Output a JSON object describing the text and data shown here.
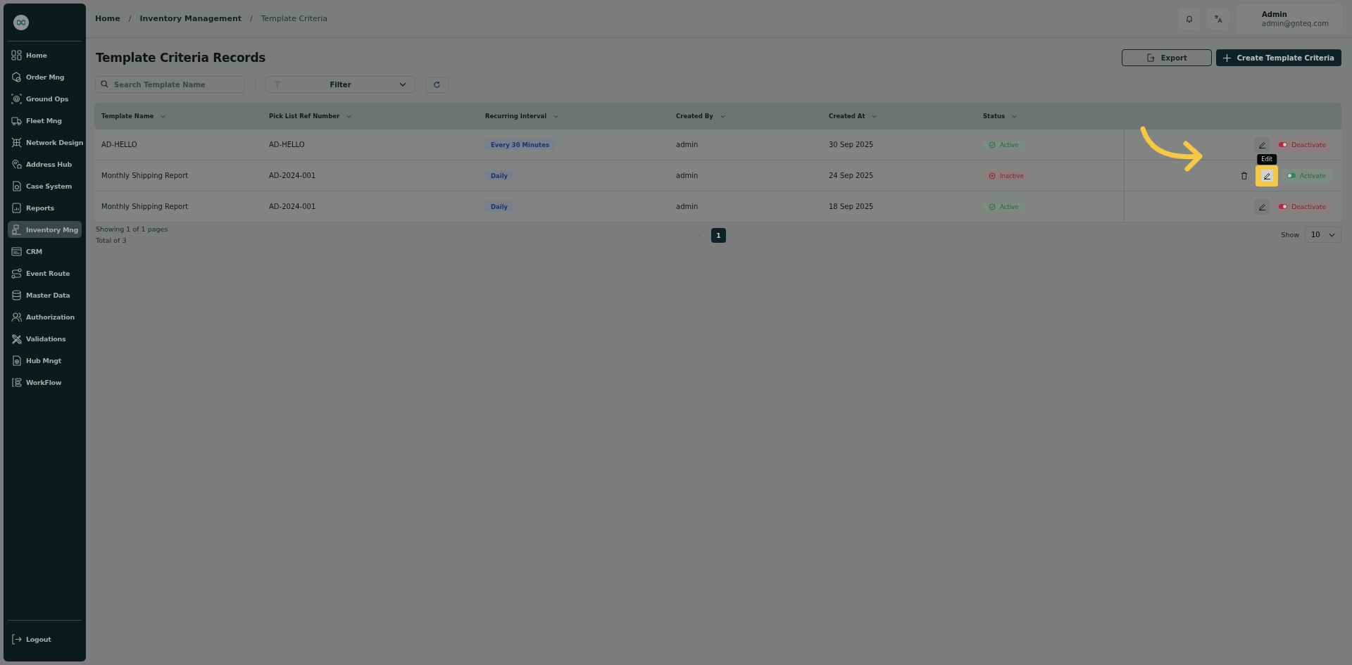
{
  "sidebar": {
    "items": [
      {
        "label": "Home",
        "selected": false
      },
      {
        "label": "Order Mng",
        "selected": false
      },
      {
        "label": "Ground Ops",
        "selected": false
      },
      {
        "label": "Fleet Mng",
        "selected": false
      },
      {
        "label": "Network Design",
        "selected": false
      },
      {
        "label": "Address Hub",
        "selected": false
      },
      {
        "label": "Case System",
        "selected": false
      },
      {
        "label": "Reports",
        "selected": false
      },
      {
        "label": "Inventory Mng",
        "selected": true
      },
      {
        "label": "CRM",
        "selected": false
      },
      {
        "label": "Event Route",
        "selected": false
      },
      {
        "label": "Master Data",
        "selected": false
      },
      {
        "label": "Authorization",
        "selected": false
      },
      {
        "label": "Validations",
        "selected": false
      },
      {
        "label": "Hub Mngt",
        "selected": false
      },
      {
        "label": "WorkFlow",
        "selected": false
      }
    ],
    "logout": "Logout"
  },
  "breadcrumb": [
    {
      "label": "Home",
      "current": false
    },
    {
      "label": "Inventory Management",
      "current": false
    },
    {
      "label": "Template Criteria",
      "current": true
    }
  ],
  "breadcrumb_separator": "/",
  "user": {
    "name": "Admin",
    "email": "admin@gnteq.com"
  },
  "page_title": "Template Criteria Records",
  "buttons": [
    {
      "label": "Export",
      "kind": "outline"
    },
    {
      "label": "Create Template Criteria",
      "kind": "primary"
    }
  ],
  "search": {
    "placeholder": "Search Template Name"
  },
  "filter": {
    "label": "Filter"
  },
  "table": {
    "columns": [
      "Template Name",
      "Pick List Ref Number",
      "Recurring Interval",
      "Created By",
      "Created At",
      "Status"
    ],
    "rows": [
      {
        "cells": [
          "AD-HELLO",
          "AD-HELLO",
          "Every 30 Minutes",
          "admin",
          "30 Sep 2025",
          "Active"
        ],
        "active": true,
        "actions": [
          {
            "kind": "edit",
            "highlighted": false
          },
          {
            "kind": "toggle",
            "label": "Deactivate",
            "on": true
          }
        ]
      },
      {
        "cells": [
          "Monthly Shipping Report",
          "AD-2024-001",
          "Daily",
          "admin",
          "24 Sep 2025",
          "Inactive"
        ],
        "active": false,
        "actions": [
          {
            "kind": "delete",
            "highlighted": false
          },
          {
            "kind": "edit",
            "highlighted": true,
            "tooltip": "Edit"
          },
          {
            "kind": "toggle",
            "label": "Activate",
            "on": false
          }
        ]
      },
      {
        "cells": [
          "Monthly Shipping Report",
          "AD-2024-001",
          "Daily",
          "admin",
          "18 Sep 2025",
          "Active"
        ],
        "active": true,
        "actions": [
          {
            "kind": "edit",
            "highlighted": false
          },
          {
            "kind": "toggle",
            "label": "Deactivate",
            "on": true
          }
        ]
      }
    ]
  },
  "pagination": {
    "summary": "Showing 1 of 1 pages",
    "total": "Total of 3",
    "pages": [
      {
        "label": "1",
        "selected": true
      }
    ],
    "show_label": "Show",
    "page_size": "10"
  }
}
